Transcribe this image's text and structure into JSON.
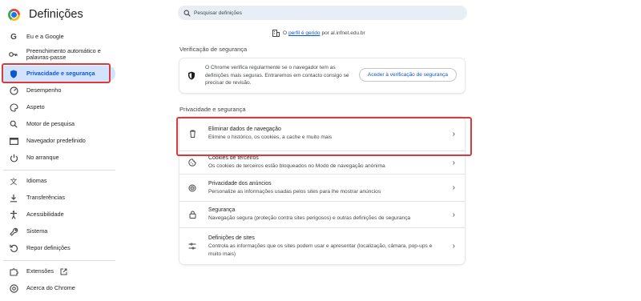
{
  "header": {
    "title": "Definições",
    "search_placeholder": "Pesquisar definições"
  },
  "sidebar": {
    "items": [
      {
        "label": "Eu e a Google",
        "icon": "google-icon"
      },
      {
        "label": "Preenchimento automático e palavras-passe",
        "icon": "key-icon"
      },
      {
        "label": "Privacidade e segurança",
        "icon": "shield-icon",
        "active": true
      },
      {
        "label": "Desempenho",
        "icon": "speedometer-icon"
      },
      {
        "label": "Aspeto",
        "icon": "palette-icon"
      },
      {
        "label": "Motor de pesquisa",
        "icon": "search-icon"
      },
      {
        "label": "Navegador predefinido",
        "icon": "browser-icon"
      },
      {
        "label": "No arranque",
        "icon": "power-icon"
      },
      {
        "label": "Idiomas",
        "icon": "translate-icon"
      },
      {
        "label": "Transferências",
        "icon": "download-icon"
      },
      {
        "label": "Acessibilidade",
        "icon": "accessibility-icon"
      },
      {
        "label": "Sistema",
        "icon": "wrench-icon"
      },
      {
        "label": "Repor definições",
        "icon": "reset-icon"
      },
      {
        "label": "Extensões",
        "icon": "puzzle-icon"
      },
      {
        "label": "Acerca do Chrome",
        "icon": "chrome-icon"
      }
    ]
  },
  "managed": {
    "prefix": "O",
    "link": "perfil é gerido",
    "suffix": "por al.infnet.edu.br"
  },
  "safety_check": {
    "title": "Verificação de segurança",
    "text": "O Chrome verifica regularmente se o navegador tem as definições mais seguras. Entraremos em contacto consigo se precisar de revisão.",
    "button": "Aceder à verificação de segurança"
  },
  "privacy": {
    "title": "Privacidade e segurança",
    "rows": [
      {
        "title": "Eliminar dados de navegação",
        "subtitle": "Elimine o histórico, os cookies, a cache e muito mais",
        "icon": "trash-icon"
      },
      {
        "title": "Cookies de terceiros",
        "subtitle": "Os cookies de terceiros estão bloqueados no Modo de navegação anónima",
        "icon": "cookie-icon"
      },
      {
        "title": "Privacidade dos anúncios",
        "subtitle": "Personalize as informações usadas pelos sites para lhe mostrar anúncios",
        "icon": "ad-privacy-icon"
      },
      {
        "title": "Segurança",
        "subtitle": "Navegação segura (proteção contra sites perigosos) e outras definições de segurança",
        "icon": "lock-icon"
      },
      {
        "title": "Definições de sites",
        "subtitle": "Controla as informações que os sites podem usar e apresentar (localização, câmara, pop-ups e muito mais)",
        "icon": "sliders-icon"
      }
    ]
  },
  "colors": {
    "accent": "#0b57d0",
    "active_bg": "#d3e3fd",
    "highlight": "#d93a3a"
  }
}
